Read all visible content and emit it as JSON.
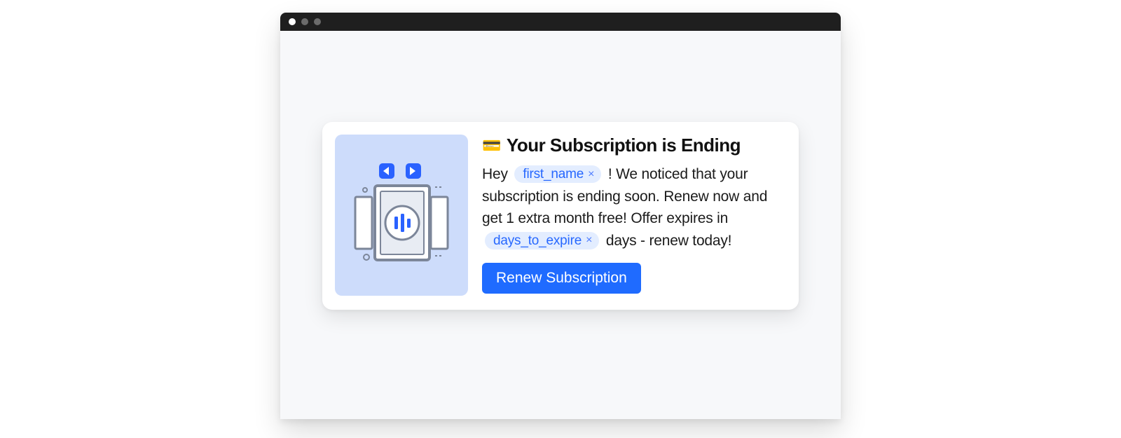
{
  "heading": {
    "emoji": "💳",
    "text": "Your Subscription is Ending"
  },
  "body": {
    "part1": "Hey",
    "chip1_label": "first_name",
    "part2": "! We noticed that your subscription is ending soon. Renew now and get 1 extra month free! Offer expires in",
    "chip2_label": "days_to_expire",
    "part3": "days - renew today!"
  },
  "cta_label": "Renew Subscription",
  "chip_close_glyph": "×"
}
